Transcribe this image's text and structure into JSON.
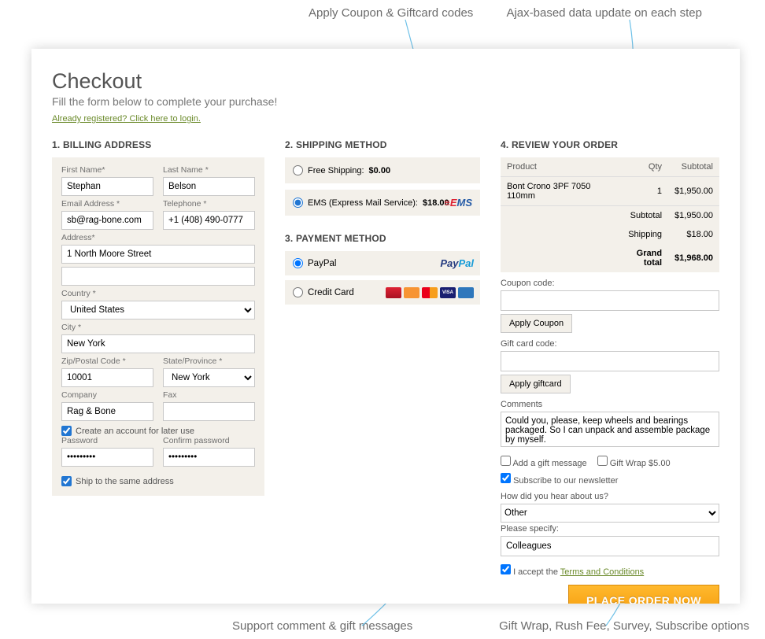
{
  "annotations": {
    "topLeft": "Apply Coupon & Giftcard codes",
    "topRight": "Ajax-based data update on each step",
    "botLeft": "Support comment & gift messages",
    "botRight": "Gift Wrap, Rush Fee, Survey, Subscribe options"
  },
  "header": {
    "title": "Checkout",
    "subtitle": "Fill the form below to complete your purchase!",
    "loginLink": "Already registered? Click here to login."
  },
  "billing": {
    "title": "1. BILLING ADDRESS",
    "firstNameLabel": "First Name*",
    "firstName": "Stephan",
    "lastNameLabel": "Last Name *",
    "lastName": "Belson",
    "emailLabel": "Email Address *",
    "email": "sb@rag-bone.com",
    "phoneLabel": "Telephone *",
    "phone": "+1 (408) 490-0777",
    "addressLabel": "Address*",
    "address1": "1 North Moore Street",
    "address2": "",
    "countryLabel": "Country *",
    "country": "United States",
    "cityLabel": "City *",
    "city": "New York",
    "zipLabel": "Zip/Postal Code *",
    "zip": "10001",
    "stateLabel": "State/Province *",
    "state": "New York",
    "companyLabel": "Company",
    "company": "Rag & Bone",
    "faxLabel": "Fax",
    "fax": "",
    "createAccount": "Create an account for later use",
    "passwordLabel": "Password",
    "password": "•••••••••",
    "confirmLabel": "Confirm password",
    "confirm": "•••••••••",
    "shipSame": "Ship to the same address"
  },
  "shipping": {
    "title": "2. SHIPPING METHOD",
    "free": {
      "label": "Free Shipping:",
      "price": "$0.00"
    },
    "ems": {
      "label": "EMS (Express Mail Service):",
      "price": "$18.00"
    }
  },
  "payment": {
    "title": "3. PAYMENT METHOD",
    "paypal": "PayPal",
    "cc": "Credit Card"
  },
  "review": {
    "title": "4. REVIEW YOUR ORDER",
    "headers": {
      "product": "Product",
      "qty": "Qty",
      "subtotal": "Subtotal"
    },
    "item": {
      "name": "Bont Crono 3PF 7050 110mm",
      "qty": "1",
      "price": "$1,950.00"
    },
    "subtotalLabel": "Subtotal",
    "subtotal": "$1,950.00",
    "shippingLabel": "Shipping",
    "shipping": "$18.00",
    "grandLabel": "Grand total",
    "grand": "$1,968.00",
    "couponLabel": "Coupon code:",
    "applyCoupon": "Apply Coupon",
    "giftLabel": "Gift card code:",
    "applyGift": "Apply giftcard",
    "commentsLabel": "Comments",
    "comments": "Could you, please, keep wheels and bearings packaged. So I can unpack and assemble package by myself.",
    "giftMsg": "Add a gift message",
    "giftWrap": "Gift Wrap $5.00",
    "newsletter": "Subscribe to our newsletter",
    "hearLabel": "How did you hear about us?",
    "hear": "Other",
    "specifyLabel": "Please specify:",
    "specify": "Colleagues",
    "acceptPrefix": "I accept the ",
    "terms": "Terms and Conditions",
    "placeOrder": "PLACE ORDER NOW"
  }
}
